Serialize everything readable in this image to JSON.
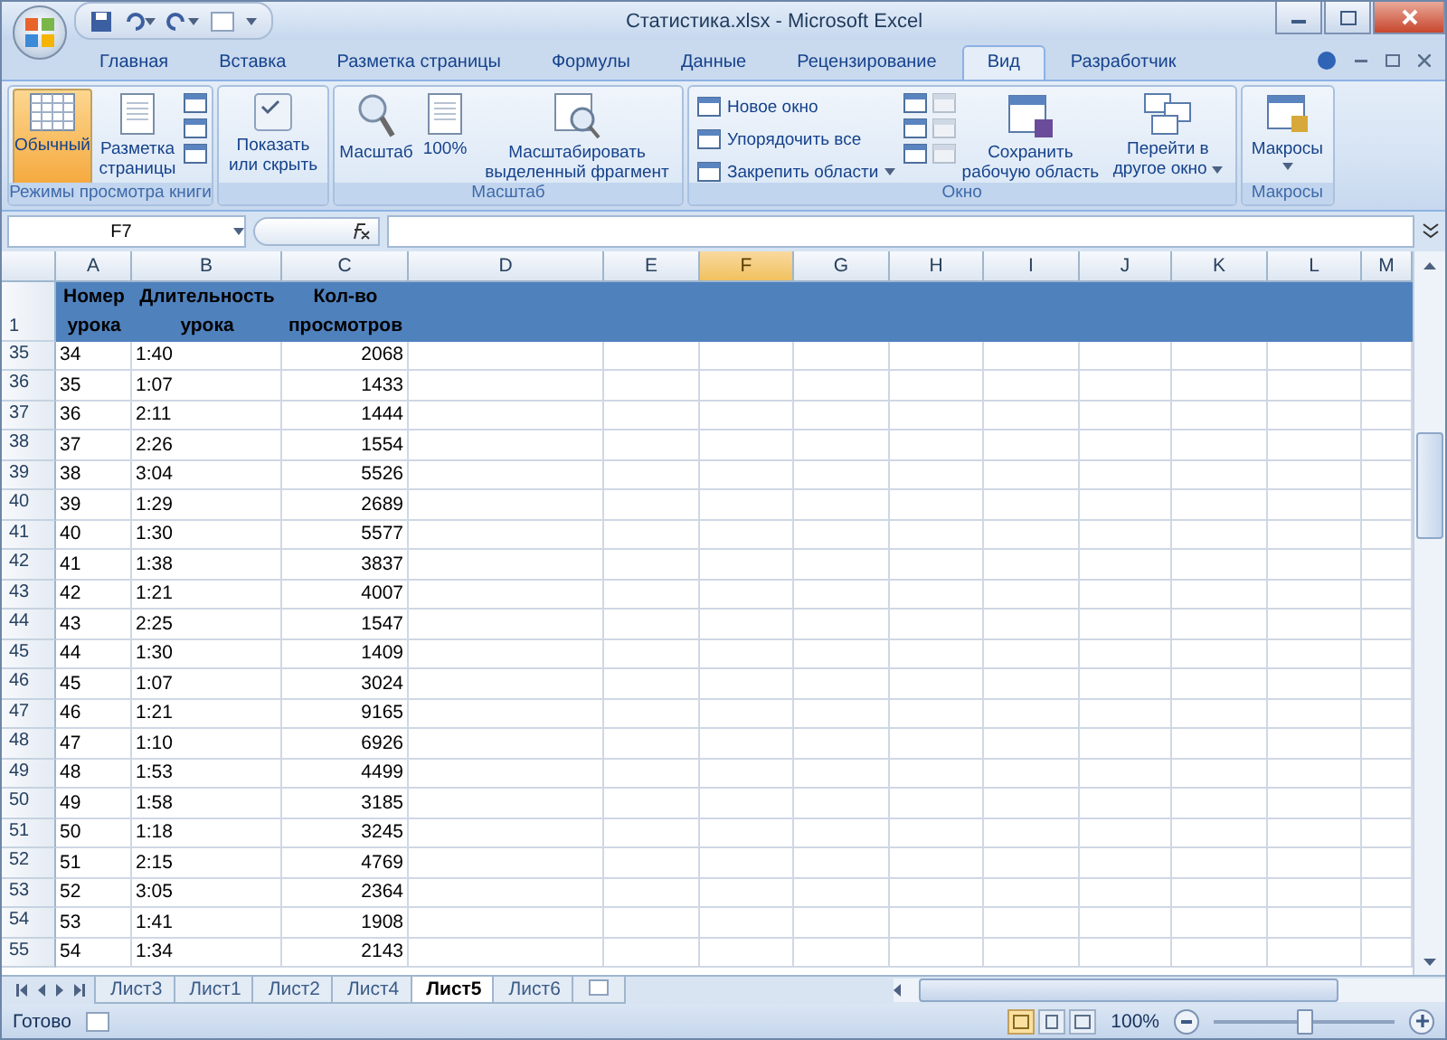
{
  "window": {
    "title": "Статистика.xlsx - Microsoft Excel"
  },
  "tabs": [
    {
      "label": "Главная",
      "selected": false
    },
    {
      "label": "Вставка",
      "selected": false
    },
    {
      "label": "Разметка страницы",
      "selected": false
    },
    {
      "label": "Формулы",
      "selected": false
    },
    {
      "label": "Данные",
      "selected": false
    },
    {
      "label": "Рецензирование",
      "selected": false
    },
    {
      "label": "Вид",
      "selected": true
    },
    {
      "label": "Разработчик",
      "selected": false
    }
  ],
  "ribbon": {
    "groups": [
      {
        "kind": "views",
        "label": "Режимы просмотра книги",
        "buttons": [
          {
            "label": "Обычный",
            "selected": true
          },
          {
            "label": "Разметка страницы",
            "selected": false
          }
        ]
      },
      {
        "kind": "show",
        "buttons": [
          {
            "label": "Показать или скрыть",
            "selected": false
          }
        ]
      },
      {
        "kind": "zoom",
        "label": "Масштаб",
        "buttons": [
          {
            "label": "Масштаб",
            "selected": false
          },
          {
            "label": "100%",
            "selected": false
          },
          {
            "label": "Масштабировать выделенный фрагмент",
            "selected": false
          }
        ]
      },
      {
        "kind": "window",
        "label": "Окно",
        "small_buttons": [
          "Новое окно",
          "Упорядочить все",
          "Закрепить области"
        ],
        "buttons": [
          {
            "label": "Сохранить рабочую область",
            "selected": false
          },
          {
            "label": "Перейти в другое окно",
            "selected": false
          }
        ]
      },
      {
        "kind": "macros",
        "label": "Макросы",
        "buttons": [
          {
            "label": "Макросы",
            "selected": false
          }
        ]
      }
    ]
  },
  "formula_bar": {
    "name_box": "F7"
  },
  "sheet": {
    "columns": [
      {
        "label": "A",
        "selected": false
      },
      {
        "label": "B",
        "selected": false
      },
      {
        "label": "C",
        "selected": false
      },
      {
        "label": "D",
        "selected": false
      },
      {
        "label": "E",
        "selected": false
      },
      {
        "label": "F",
        "selected": true
      },
      {
        "label": "G",
        "selected": false
      },
      {
        "label": "H",
        "selected": false
      },
      {
        "label": "I",
        "selected": false
      },
      {
        "label": "J",
        "selected": false
      },
      {
        "label": "K",
        "selected": false
      },
      {
        "label": "L",
        "selected": false
      },
      {
        "label": "M",
        "selected": false
      }
    ],
    "header_row": {
      "number": "1",
      "cells": [
        "Номер урока",
        "Длительность урока",
        "Кол-во просмотров"
      ]
    },
    "rows": [
      {
        "number": "35",
        "cells": [
          "34",
          "1:40",
          "2068"
        ]
      },
      {
        "number": "36",
        "cells": [
          "35",
          "1:07",
          "1433"
        ]
      },
      {
        "number": "37",
        "cells": [
          "36",
          "2:11",
          "1444"
        ]
      },
      {
        "number": "38",
        "cells": [
          "37",
          "2:26",
          "1554"
        ]
      },
      {
        "number": "39",
        "cells": [
          "38",
          "3:04",
          "5526"
        ]
      },
      {
        "number": "40",
        "cells": [
          "39",
          "1:29",
          "2689"
        ]
      },
      {
        "number": "41",
        "cells": [
          "40",
          "1:30",
          "5577"
        ]
      },
      {
        "number": "42",
        "cells": [
          "41",
          "1:38",
          "3837"
        ]
      },
      {
        "number": "43",
        "cells": [
          "42",
          "1:21",
          "4007"
        ]
      },
      {
        "number": "44",
        "cells": [
          "43",
          "2:25",
          "1547"
        ]
      },
      {
        "number": "45",
        "cells": [
          "44",
          "1:30",
          "1409"
        ]
      },
      {
        "number": "46",
        "cells": [
          "45",
          "1:07",
          "3024"
        ]
      },
      {
        "number": "47",
        "cells": [
          "46",
          "1:21",
          "9165"
        ]
      },
      {
        "number": "48",
        "cells": [
          "47",
          "1:10",
          "6926"
        ]
      },
      {
        "number": "49",
        "cells": [
          "48",
          "1:53",
          "4499"
        ]
      },
      {
        "number": "50",
        "cells": [
          "49",
          "1:58",
          "3185"
        ]
      },
      {
        "number": "51",
        "cells": [
          "50",
          "1:18",
          "3245"
        ]
      },
      {
        "number": "52",
        "cells": [
          "51",
          "2:15",
          "4769"
        ]
      },
      {
        "number": "53",
        "cells": [
          "52",
          "3:05",
          "2364"
        ]
      },
      {
        "number": "54",
        "cells": [
          "53",
          "1:41",
          "1908"
        ]
      },
      {
        "number": "55",
        "cells": [
          "54",
          "1:34",
          "2143"
        ]
      }
    ]
  },
  "sheet_tabs": [
    {
      "label": "Лист3",
      "selected": false
    },
    {
      "label": "Лист1",
      "selected": false
    },
    {
      "label": "Лист2",
      "selected": false
    },
    {
      "label": "Лист4",
      "selected": false
    },
    {
      "label": "Лист5",
      "selected": true
    },
    {
      "label": "Лист6",
      "selected": false
    }
  ],
  "status_bar": {
    "status": "Готово",
    "zoom": "100%",
    "zoom_slider": {
      "level": 0.5
    }
  }
}
